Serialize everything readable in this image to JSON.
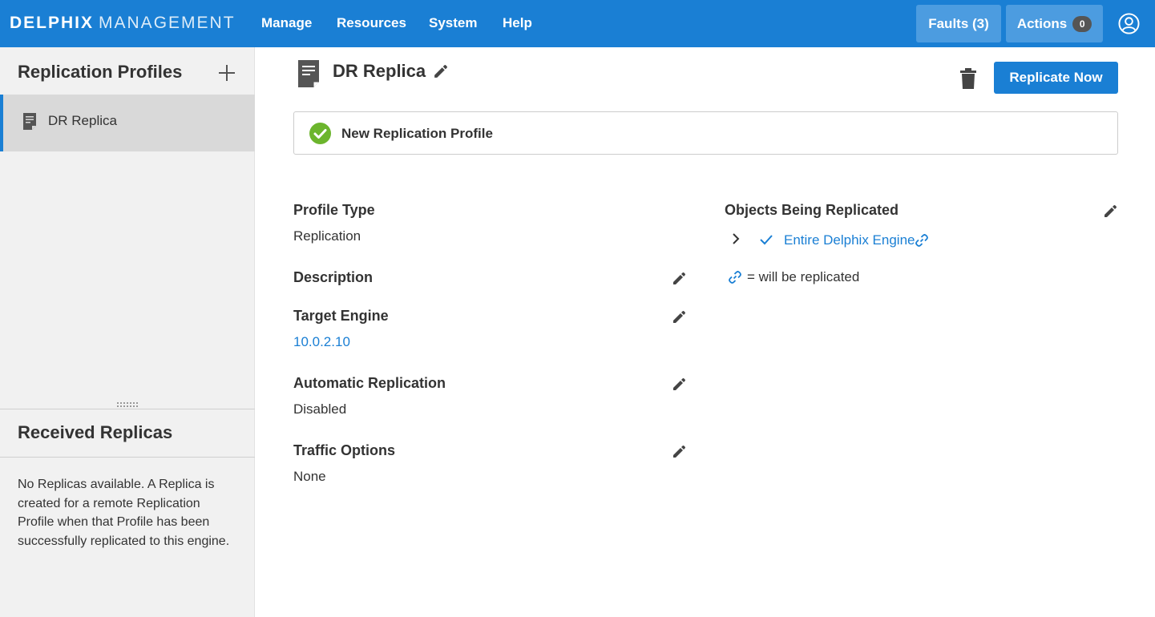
{
  "topbar": {
    "brand_bold": "DELPHIX",
    "brand_light": "MANAGEMENT",
    "nav": [
      "Manage",
      "Resources",
      "System",
      "Help"
    ],
    "faults_label": "Faults (3)",
    "actions_label": "Actions",
    "actions_count": "0",
    "user_icon": "user-circle-icon"
  },
  "sidebar": {
    "profiles_title": "Replication Profiles",
    "add_icon": "plus-icon",
    "profiles": [
      {
        "label": "DR Replica",
        "icon": "document-icon"
      }
    ],
    "received_title": "Received Replicas",
    "received_text": "No Replicas available. A Replica is created for a remote Replication Profile when that Profile has been successfully replicated to this engine."
  },
  "main": {
    "title": "DR Replica",
    "replicate_now_label": "Replicate Now",
    "notice": "New Replication Profile",
    "fields": {
      "profile_type": {
        "label": "Profile Type",
        "value": "Replication"
      },
      "description": {
        "label": "Description",
        "value": ""
      },
      "target_engine": {
        "label": "Target Engine",
        "value": "10.0.2.10"
      },
      "automatic_replication": {
        "label": "Automatic Replication",
        "value": "Disabled"
      },
      "traffic_options": {
        "label": "Traffic Options",
        "value": "None"
      }
    },
    "objects": {
      "label": "Objects Being Replicated",
      "item": "Entire Delphix Engine",
      "legend": "= will be replicated"
    }
  },
  "colors": {
    "accent": "#1a7fd4",
    "topbar_button": "#4c9ce0",
    "success": "#6cb52d",
    "sidebar_bg": "#f1f1f1",
    "selected_bg": "#d9d9d9"
  }
}
